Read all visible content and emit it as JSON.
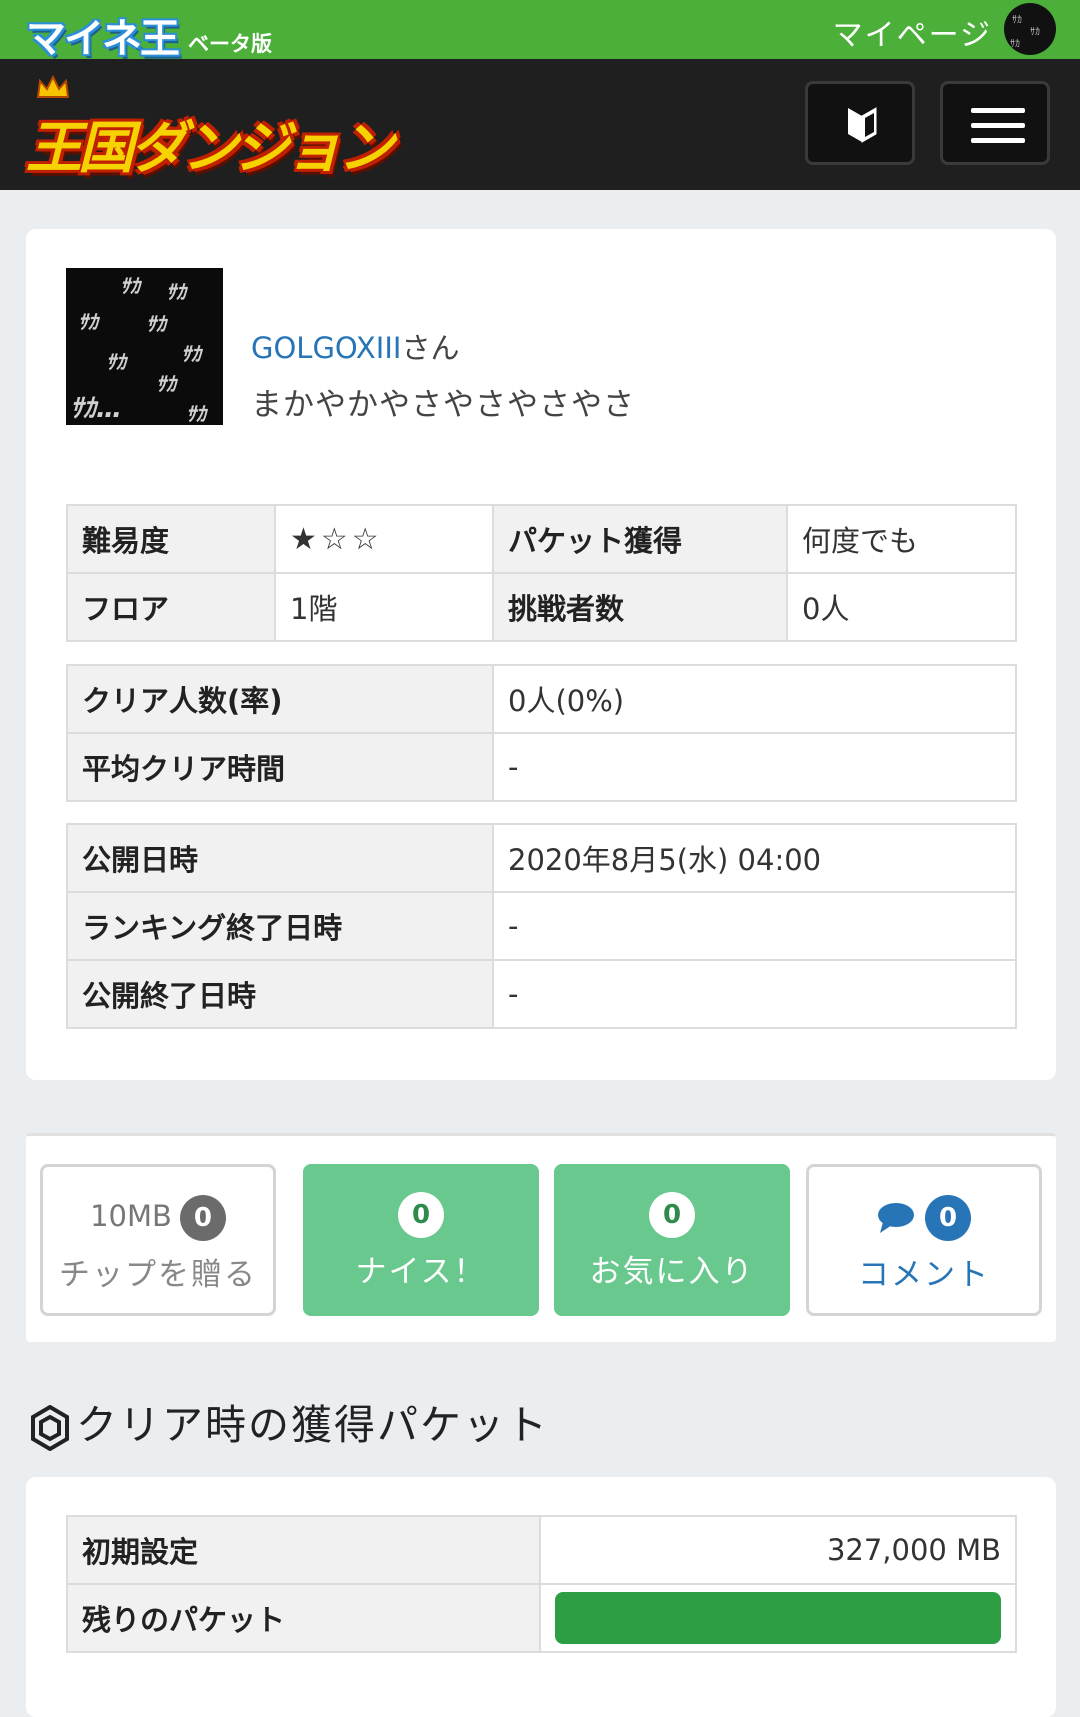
{
  "topbar": {
    "logo_text": "マイネ王",
    "beta_label": "ベータ版",
    "mypage_label": "マイページ",
    "bg_color": "#4caf3a"
  },
  "header": {
    "brand_text": "王国ダンジョン",
    "beginner_icon": "beginner-mark-icon",
    "menu_icon": "hamburger-menu-icon"
  },
  "user": {
    "name": "GOLGOXIII",
    "suffix": "さん",
    "dungeon_title": "まかやかやさやさやさやさ"
  },
  "info_table": {
    "difficulty_label": "難易度",
    "difficulty_stars": "★☆☆",
    "difficulty_level": 1,
    "difficulty_max": 3,
    "packet_label": "パケット獲得",
    "packet_value": "何度でも",
    "floor_label": "フロア",
    "floor_value": "1階",
    "challengers_label": "挑戦者数",
    "challengers_value": "0人"
  },
  "clear_table": {
    "clear_count_label": "クリア人数(率)",
    "clear_count_value": "0人(0%)",
    "avg_time_label": "平均クリア時間",
    "avg_time_value": "-"
  },
  "date_table": {
    "publish_label": "公開日時",
    "publish_value": "2020年8月5(水) 04:00",
    "ranking_end_label": "ランキング終了日時",
    "ranking_end_value": "-",
    "publish_end_label": "公開終了日時",
    "publish_end_value": "-"
  },
  "actions": {
    "chip_amount": "10MB",
    "chip_count": "0",
    "chip_label": "チップを贈る",
    "nice_count": "0",
    "nice_label": "ナイス！",
    "fav_count": "0",
    "fav_label": "お気に入り",
    "comment_count": "0",
    "comment_label": "コメント"
  },
  "packet_section": {
    "title": "クリア時の獲得パケット",
    "initial_label": "初期設定",
    "initial_value": "327,000 MB",
    "remaining_label": "残りのパケット",
    "remaining_fraction": 1.0,
    "bar_color": "#2e9e44"
  }
}
